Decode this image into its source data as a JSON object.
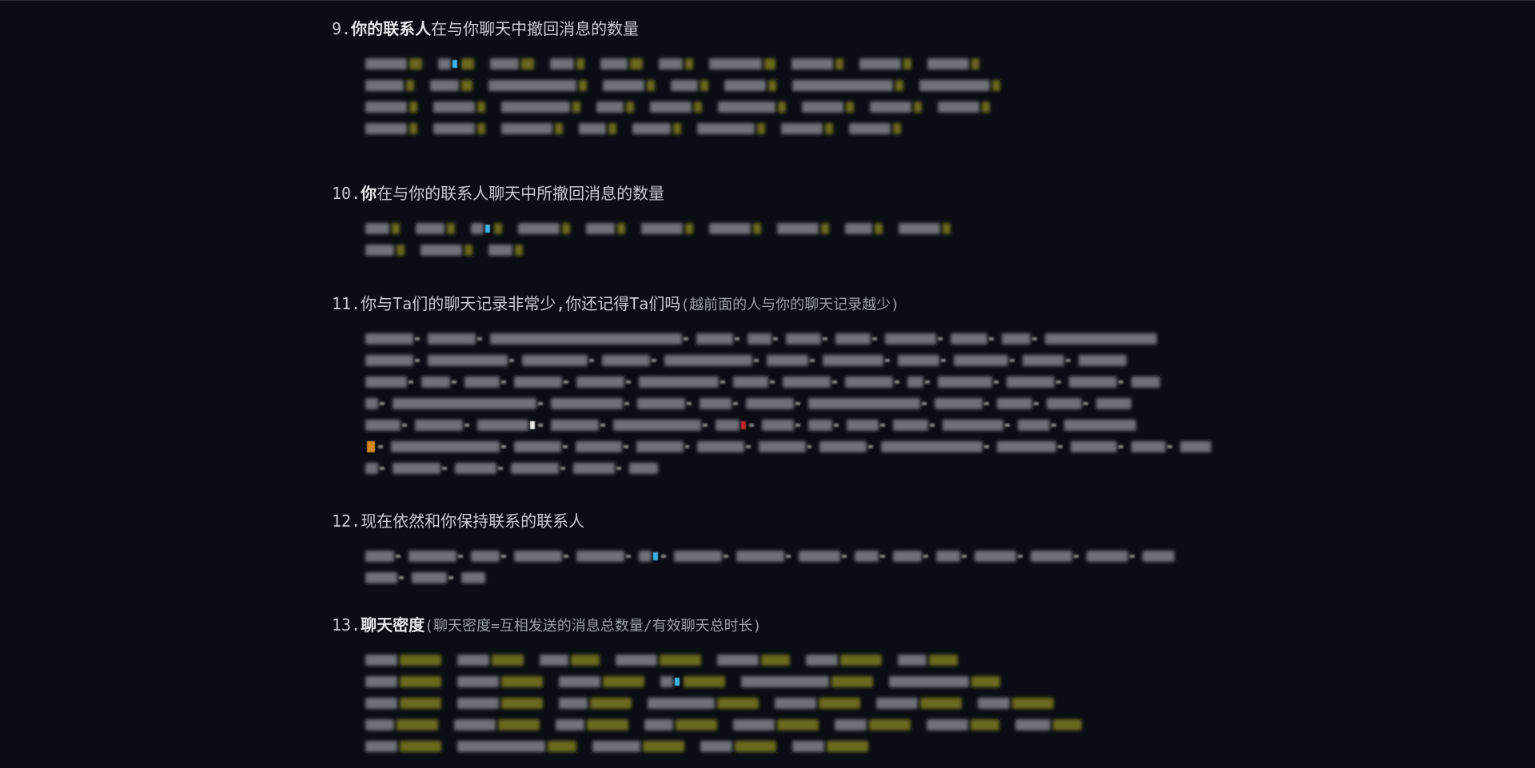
{
  "sections": [
    {
      "number": "9.",
      "bold": "你的联系人",
      "rest": "在与你聊天中撤回消息的数量",
      "note": ""
    },
    {
      "number": "10.",
      "bold": "你",
      "rest": "在与你的联系人聊天中所撤回消息的数量",
      "note": ""
    },
    {
      "number": "11.",
      "bold": "",
      "rest": "你与Ta们的聊天记录非常少,你还记得Ta们吗",
      "note": "(越前面的人与你的聊天记录越少)"
    },
    {
      "number": "12.",
      "bold": "",
      "rest": "现在依然和你保持联系的联系人",
      "note": ""
    },
    {
      "number": "13.",
      "bold": "聊天密度",
      "rest": "",
      "note": "(聊天密度=互相发送的消息总数量/有效聊天总时长)"
    }
  ],
  "colors": {
    "background": "#0a0d13",
    "text": "#c9ccd3",
    "blurred_name": "#6f7278",
    "blurred_value": "#6a6a1e",
    "accent_blue": "#3fb6e6",
    "accent_red": "#c0282e",
    "accent_orange": "#d48a1a"
  }
}
